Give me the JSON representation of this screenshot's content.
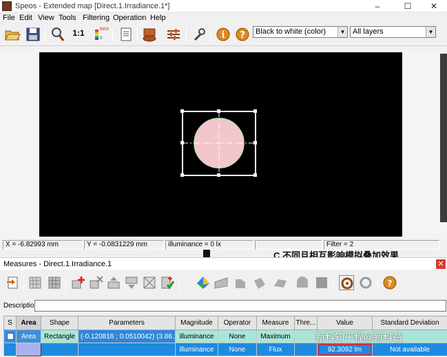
{
  "window": {
    "title": "Speos - Extended map [Direct.1.Irradiance.1*]",
    "minimize": "–",
    "maximize": "☐",
    "close": "✕"
  },
  "menu": [
    "File",
    "Edit",
    "View",
    "Tools",
    "Filtering",
    "Operation",
    "Help"
  ],
  "toolbar": {
    "colormap_select": "Black to white (color)",
    "layers_select": "All layers",
    "scale_label": "1:1",
    "max_label": "MAX",
    "min_label": "0",
    "info_icon": "i",
    "help_icon": "?"
  },
  "status": {
    "x": "X = -6.82993 mm",
    "y": "Y = -0.0831229 mm",
    "illuminance": "illuminance = 0 lx",
    "filter": "Filter = 2"
  },
  "overlay_text": "C 不同且相互影响模拟叠加效果",
  "measures": {
    "title": "Measures - Direct.1.Irradiance.1",
    "close": "✕",
    "description_label": "Description:",
    "description_value": "",
    "columns": [
      "S",
      "Area",
      "Shape",
      "Parameters",
      "Magnitude",
      "Operator",
      "Measure",
      "Thre...",
      "Value",
      "Standard Deviation"
    ],
    "rows": [
      {
        "area": "Area",
        "shape": "Rectangle",
        "parameters": "(-0.120816 ; 0.0510042) (3.86...",
        "magnitude": "illuminance",
        "operator": "None",
        "measure": "Maximum",
        "threshold": "",
        "value": "",
        "std": ""
      },
      {
        "area": "",
        "shape": "",
        "parameters": "",
        "magnitude": "illuminance",
        "operator": "None",
        "measure": "Flux",
        "threshold": "",
        "value": "92.3092 lm",
        "std": "Not available"
      }
    ]
  },
  "watermark": "新科知乎程@新科益",
  "colors": {
    "map_bg": "#000000",
    "spot_fill": "#f2c6cc",
    "selection_row": "#1e8ae0",
    "highlight_value": "#d0303a"
  }
}
